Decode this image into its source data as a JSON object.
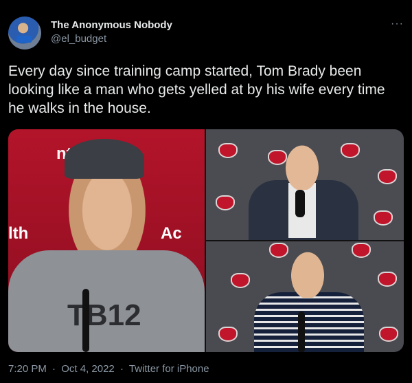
{
  "author": {
    "name": "The Anonymous Nobody",
    "handle": "@el_budget"
  },
  "more_label": "···",
  "tweet_text": "Every day since training camp started, Tom Brady been looking like a man who gets yelled at by his wife every time he walks in the house.",
  "media": {
    "left_sponsor_text": "ntHealt",
    "left_sponsor_text_2": "lth",
    "left_sponsor_text_3": "Ac",
    "shirt_logo": "TB12"
  },
  "meta": {
    "time": "7:20 PM",
    "separator": "·",
    "date": "Oct 4, 2022",
    "client": "Twitter for iPhone"
  }
}
